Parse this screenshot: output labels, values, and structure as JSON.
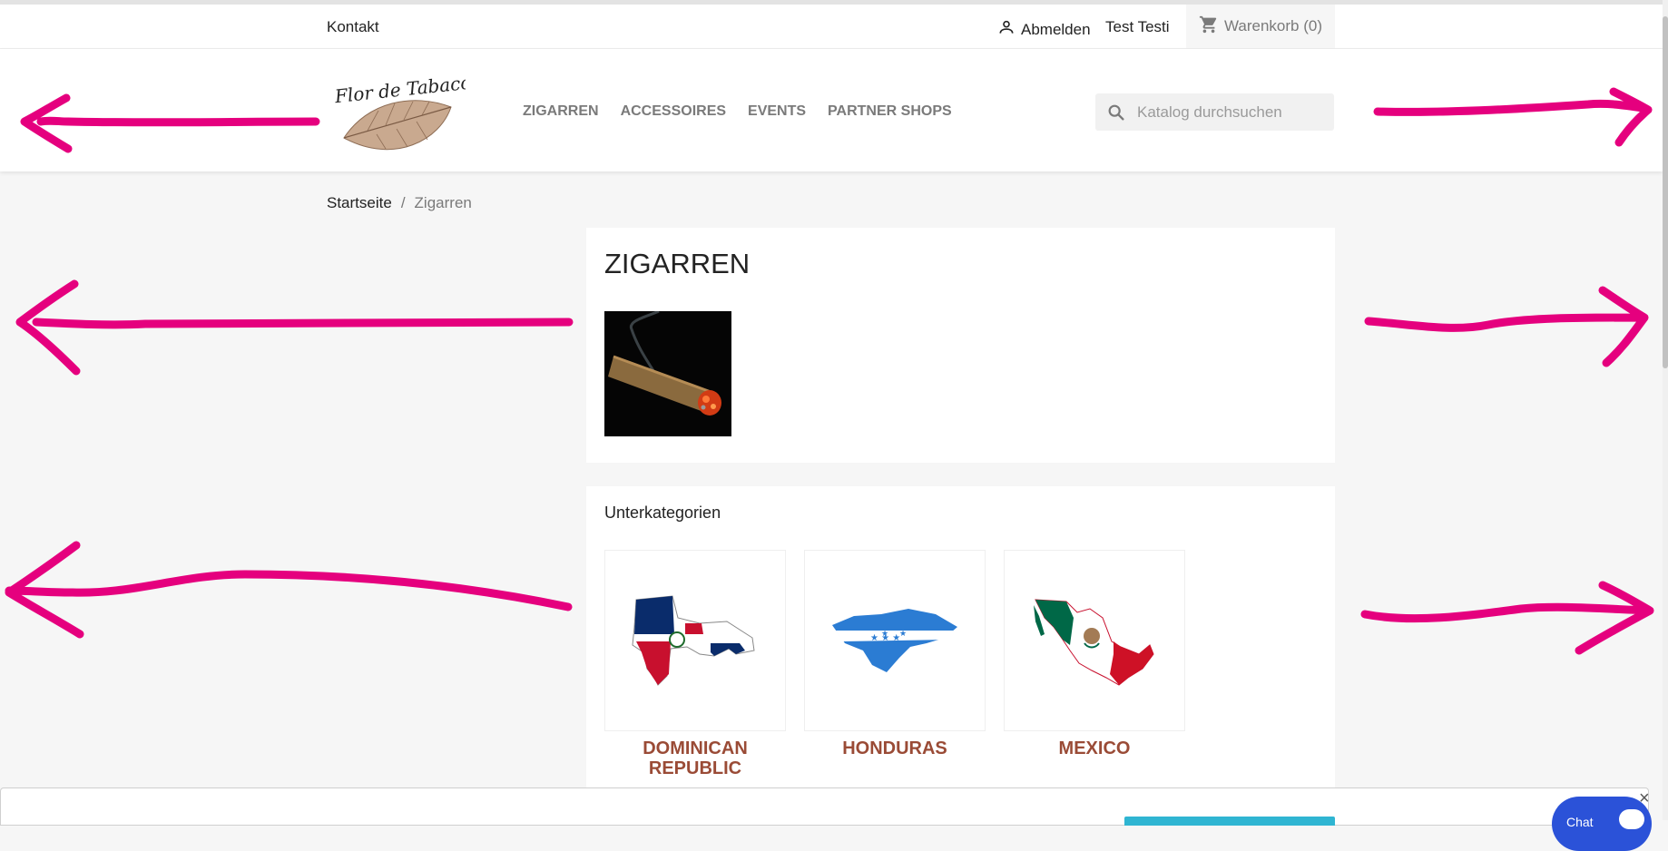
{
  "topbar": {
    "contact": "Kontakt",
    "signout": "Abmelden",
    "username": "Test Testi",
    "cart": "Warenkorb (0)"
  },
  "header": {
    "logo_text": "Flor de Tabaco",
    "nav": [
      "ZIGARREN",
      "ACCESSOIRES",
      "EVENTS",
      "PARTNER SHOPS"
    ],
    "search_placeholder": "Katalog durchsuchen"
  },
  "breadcrumb": {
    "home": "Startseite",
    "separator": "/",
    "current": "Zigarren"
  },
  "category": {
    "title": "ZIGARREN"
  },
  "subcategories": {
    "title": "Unterkategorien",
    "items": [
      {
        "name": "DOMINICAN REPUBLIC",
        "icon": "dominican-republic-flag-map"
      },
      {
        "name": "HONDURAS",
        "icon": "honduras-flag-map"
      },
      {
        "name": "MEXICO",
        "icon": "mexico-flag-map"
      }
    ]
  },
  "chat": {
    "label": "Chat"
  },
  "colors": {
    "accent": "#e5007e",
    "subcategory_text": "#9a4b36",
    "cookie_button": "#2fb5d2",
    "chat": "#2b52d8"
  }
}
